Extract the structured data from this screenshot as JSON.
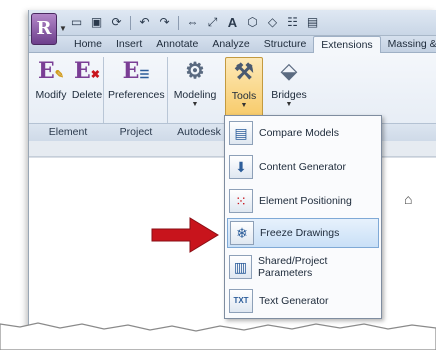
{
  "app": {
    "button_letter": "R"
  },
  "qat": {
    "icons": [
      "open-folder-icon",
      "save-icon",
      "sync-icon",
      "undo-icon",
      "redo-icon",
      "measure-icon",
      "dimension-icon",
      "text-icon",
      "3d-view-icon",
      "tag-icon",
      "settings-icon",
      "window-icon"
    ]
  },
  "tabs": [
    {
      "label": "Home",
      "active": false
    },
    {
      "label": "Insert",
      "active": false
    },
    {
      "label": "Annotate",
      "active": false
    },
    {
      "label": "Analyze",
      "active": false
    },
    {
      "label": "Structure",
      "active": false
    },
    {
      "label": "Extensions",
      "active": true
    },
    {
      "label": "Massing &",
      "active": false
    }
  ],
  "ribbon": {
    "buttons": [
      {
        "label": "Modify",
        "icon": "E",
        "color": "#7a3e95"
      },
      {
        "label": "Delete",
        "icon": "E",
        "color": "#7a3e95"
      },
      {
        "label": "Preferences",
        "icon": "E",
        "color": "#7a3e95"
      },
      {
        "label": "Modeling",
        "icon": "modeling-icon"
      },
      {
        "label": "Tools",
        "icon": "tools-icon",
        "pressed": true
      },
      {
        "label": "Bridges",
        "icon": "bridges-icon"
      }
    ],
    "panels": [
      "Element",
      "Project",
      "Autodesk"
    ]
  },
  "menu": {
    "items": [
      {
        "label": "Compare Models",
        "icon": "compare-models-icon",
        "highlighted": false
      },
      {
        "label": "Content Generator",
        "icon": "content-generator-icon",
        "highlighted": false
      },
      {
        "label": "Element Positioning",
        "icon": "element-positioning-icon",
        "highlighted": false
      },
      {
        "label": "Freeze Drawings",
        "icon": "freeze-drawings-icon",
        "highlighted": true
      },
      {
        "label": "Shared/Project Parameters",
        "icon": "shared-parameters-icon",
        "highlighted": false
      },
      {
        "label": "Text Generator",
        "icon": "text-generator-icon",
        "highlighted": false,
        "glyph": "TXT"
      }
    ]
  },
  "colors": {
    "accent_red": "#c8141c",
    "highlight": "#c9e0f7",
    "app_purple": "#6d3f8c"
  }
}
